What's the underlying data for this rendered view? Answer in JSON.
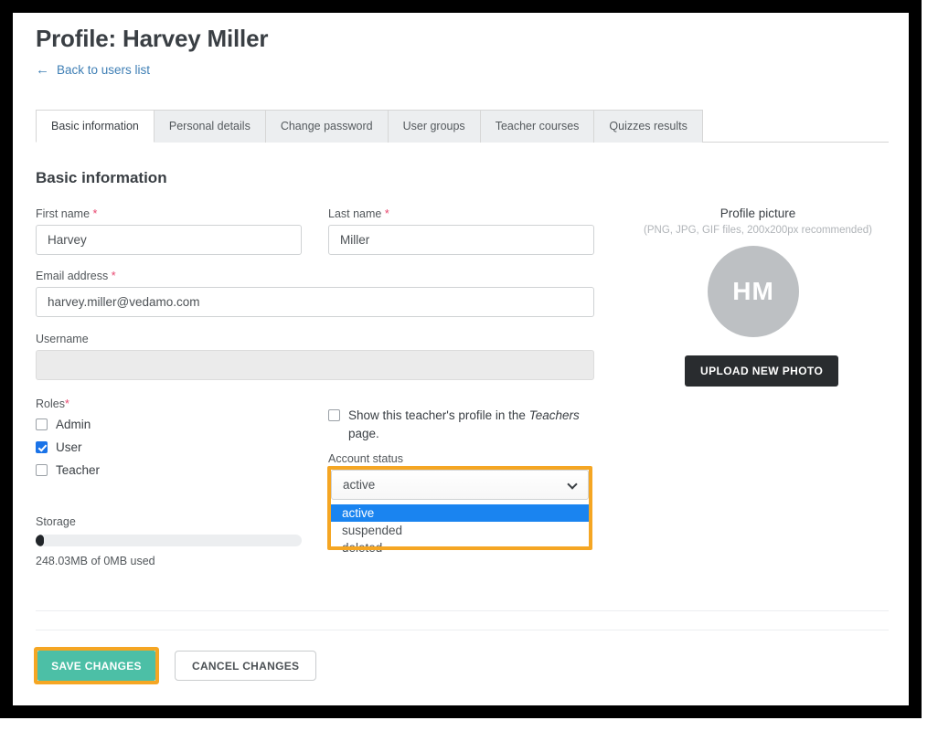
{
  "header": {
    "title": "Profile: Harvey Miller",
    "back_link": "Back to users list",
    "back_arrow_icon": "arrow-left-icon"
  },
  "tabs": [
    {
      "label": "Basic information",
      "active": true
    },
    {
      "label": "Personal details",
      "active": false
    },
    {
      "label": "Change password",
      "active": false
    },
    {
      "label": "User groups",
      "active": false
    },
    {
      "label": "Teacher courses",
      "active": false
    },
    {
      "label": "Quizzes results",
      "active": false
    }
  ],
  "section": {
    "title": "Basic information"
  },
  "fields": {
    "first_name": {
      "label": "First name",
      "required": "*",
      "value": "Harvey"
    },
    "last_name": {
      "label": "Last name",
      "required": "*",
      "value": "Miller"
    },
    "email": {
      "label": "Email address",
      "required": "*",
      "value": "harvey.miller@vedamo.com"
    },
    "username": {
      "label": "Username",
      "value": ""
    }
  },
  "roles": {
    "label": "Roles",
    "required": "*",
    "items": [
      {
        "label": "Admin",
        "checked": false
      },
      {
        "label": "User",
        "checked": true
      },
      {
        "label": "Teacher",
        "checked": false
      }
    ]
  },
  "storage": {
    "label": "Storage",
    "used_text": "248.03MB of 0MB used",
    "percent": 3
  },
  "teacher_profile": {
    "checked": false,
    "text_before": "Show this teacher's profile in the ",
    "text_emphasis": "Teachers",
    "text_after": " page."
  },
  "account_status": {
    "label": "Account status",
    "selected": "active",
    "expanded": true,
    "chevron_icon": "chevron-down-icon",
    "options": [
      {
        "label": "active",
        "selected": true
      },
      {
        "label": "suspended",
        "selected": false
      },
      {
        "label": "deleted",
        "selected": false
      }
    ]
  },
  "profile_picture": {
    "title": "Profile picture",
    "hint": "(PNG, JPG, GIF files, 200x200px recommended)",
    "initials": "HM",
    "upload_label": "UPLOAD NEW PHOTO"
  },
  "footer": {
    "save_label": "SAVE CHANGES",
    "cancel_label": "CANCEL CHANGES"
  },
  "colors": {
    "highlight": "#f5a623",
    "save_button": "#4cbfa6",
    "link": "#3f7fb5",
    "required": "#e8476f",
    "option_selected": "#1a84f0",
    "checkbox_checked": "#1a73e8",
    "avatar": "#bdc0c3",
    "upload_button": "#292c2f"
  }
}
